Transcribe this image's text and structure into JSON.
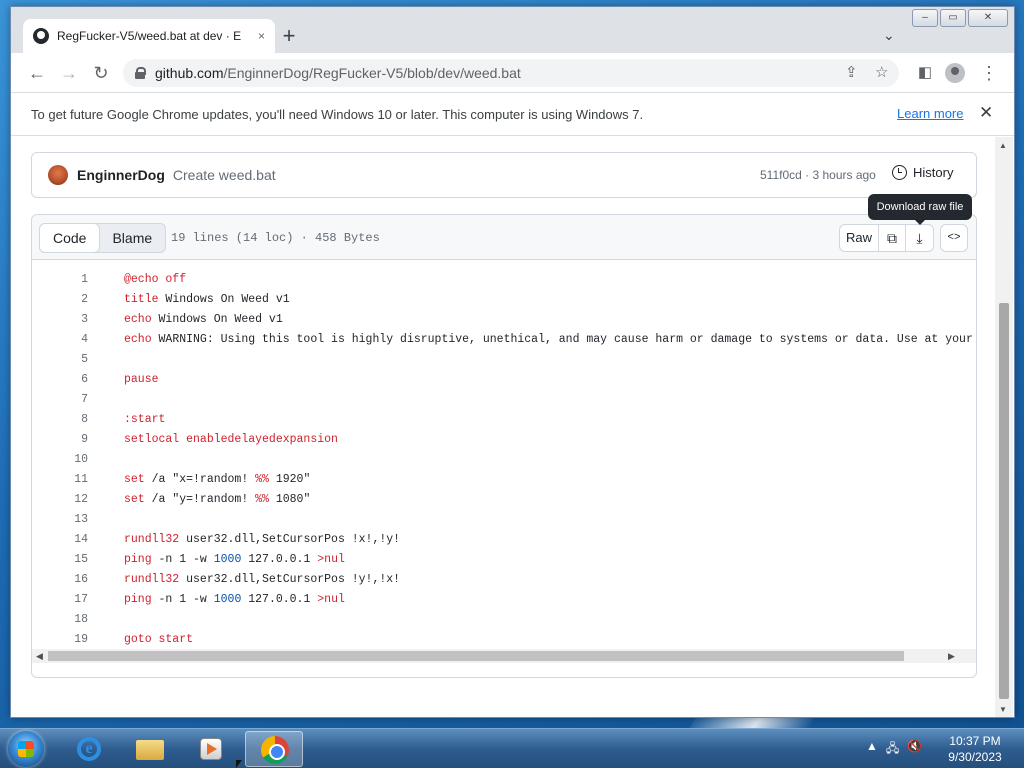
{
  "browser": {
    "tab_title": "RegFucker-V5/weed.bat at dev · E",
    "tab_close": "×",
    "new_tab": "+",
    "url_host": "github.com",
    "url_path": "/EnginnerDog/RegFucker-V5/blob/dev/weed.bat",
    "window_controls": {
      "minimize": "–",
      "maximize": "▭",
      "close": "✕"
    }
  },
  "infobar": {
    "message": "To get future Google Chrome updates, you'll need Windows 10 or later. This computer is using Windows 7.",
    "learn_more": "Learn more",
    "close": "✕"
  },
  "commit": {
    "author": "EnginnerDog",
    "message": "Create weed.bat",
    "meta": "511f0cd · 3 hours ago",
    "history_label": "History"
  },
  "file": {
    "tab_code": "Code",
    "tab_blame": "Blame",
    "info": "19 lines (14 loc) · 458 Bytes",
    "raw_label": "Raw",
    "tooltip": "Download raw file"
  },
  "code_lines": [
    {
      "n": "1",
      "text": "@echo off"
    },
    {
      "n": "2",
      "text": "title Windows On Weed v1"
    },
    {
      "n": "3",
      "text": "echo Windows On Weed v1"
    },
    {
      "n": "4",
      "text": "echo WARNING: Using this tool is highly disruptive, unethical, and may cause harm or damage to systems or data. Use at your own ri"
    },
    {
      "n": "5",
      "text": ""
    },
    {
      "n": "6",
      "text": "pause"
    },
    {
      "n": "7",
      "text": ""
    },
    {
      "n": "8",
      "text": ":start"
    },
    {
      "n": "9",
      "text": "setlocal enabledelayedexpansion"
    },
    {
      "n": "10",
      "text": ""
    },
    {
      "n": "11",
      "text": "set /a \"x=!random! %% 1920\""
    },
    {
      "n": "12",
      "text": "set /a \"y=!random! %% 1080\""
    },
    {
      "n": "13",
      "text": ""
    },
    {
      "n": "14",
      "text": "rundll32 user32.dll,SetCursorPos !x!,!y!"
    },
    {
      "n": "15",
      "text": "ping -n 1 -w 1000 127.0.0.1 >nul"
    },
    {
      "n": "16",
      "text": "rundll32 user32.dll,SetCursorPos !y!,!x!"
    },
    {
      "n": "17",
      "text": "ping -n 1 -w 1000 127.0.0.1 >nul"
    },
    {
      "n": "18",
      "text": ""
    },
    {
      "n": "19",
      "text": "goto start"
    }
  ],
  "taskbar": {
    "clock_time": "10:37 PM",
    "clock_date": "9/30/2023",
    "tray_arrow": "▲"
  },
  "colors": {
    "keyword": "#cf222e",
    "number": "#0550ae",
    "link": "#1a73e8"
  }
}
